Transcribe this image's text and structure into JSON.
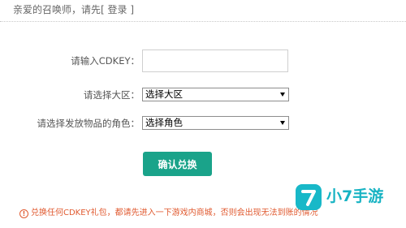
{
  "header": {
    "greeting": "亲爱的召唤师，请先",
    "login_open": "[ ",
    "login_label": "登录",
    "login_close": " ]"
  },
  "form": {
    "cdkey_label": "请输入CDKEY：",
    "cdkey_value": "",
    "region_label": "请选择大区：",
    "region_selected": "选择大区",
    "role_label": "请选择发放物品的角色：",
    "role_selected": "选择角色",
    "confirm_label": "确认兑换"
  },
  "notice": {
    "icon": "exclamation-icon",
    "text": "兑换任何CDKEY礼包，都请先进入一下游戏内商城，否则会出现无法到账的情况"
  },
  "watermark": {
    "text": "小7手游"
  },
  "colors": {
    "accent": "#1aa38a",
    "notice": "#e05a30",
    "watermark": "#17b3c3"
  }
}
